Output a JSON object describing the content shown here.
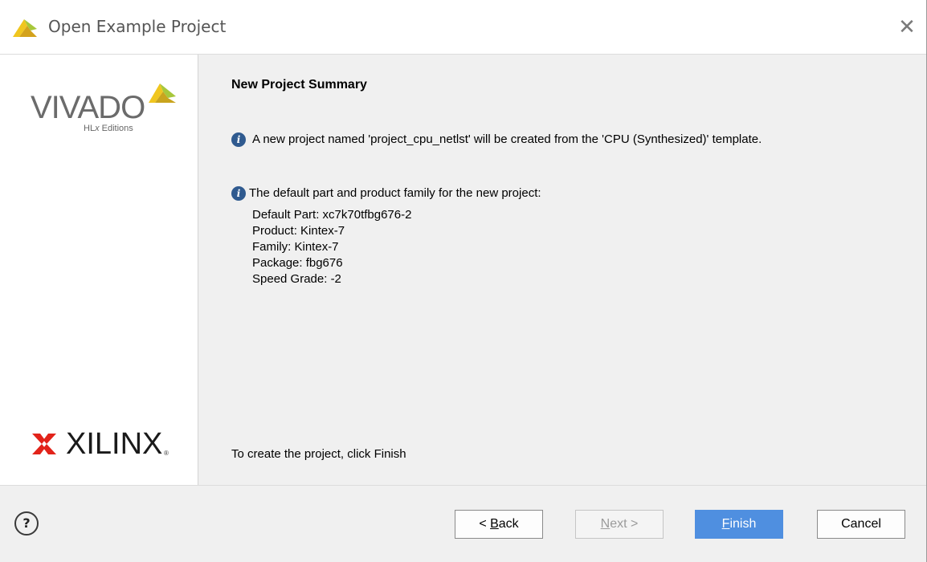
{
  "window": {
    "title": "Open Example Project",
    "close_glyph": "✕"
  },
  "sidebar": {
    "vivado_word": "VIVADO",
    "vivado_sub_prefix": "HL",
    "vivado_sub_x": "x",
    "vivado_sub_suffix": " Editions",
    "xilinx_word": "XILINX",
    "xilinx_reg": "®"
  },
  "main": {
    "heading": "New Project Summary",
    "info1": "A new project named 'project_cpu_netlst' will be created from the 'CPU (Synthesized)' template.",
    "info2": "The default part and product family for the new project:",
    "details": [
      "Default Part: xc7k70tfbg676-2",
      "Product: Kintex-7",
      "Family: Kintex-7",
      "Package: fbg676",
      "Speed Grade: -2"
    ],
    "finish_hint": "To create the project, click Finish"
  },
  "footer": {
    "help_label": "?",
    "back_prefix": "< ",
    "back_mnemonic": "B",
    "back_rest": "ack",
    "next_mnemonic": "N",
    "next_rest": "ext >",
    "finish_mnemonic": "F",
    "finish_rest": "inish",
    "cancel_label": "Cancel"
  },
  "colors": {
    "accent": "#4f8fe0",
    "info_icon": "#2f5a8f",
    "vivado_logo_yellow": "#f0c61f",
    "vivado_logo_green": "#a7c73b",
    "xilinx_red": "#e2231a"
  },
  "icons": {
    "title": "vivado-logo-icon",
    "info": "info-icon",
    "help": "help-icon",
    "close": "close-icon"
  }
}
